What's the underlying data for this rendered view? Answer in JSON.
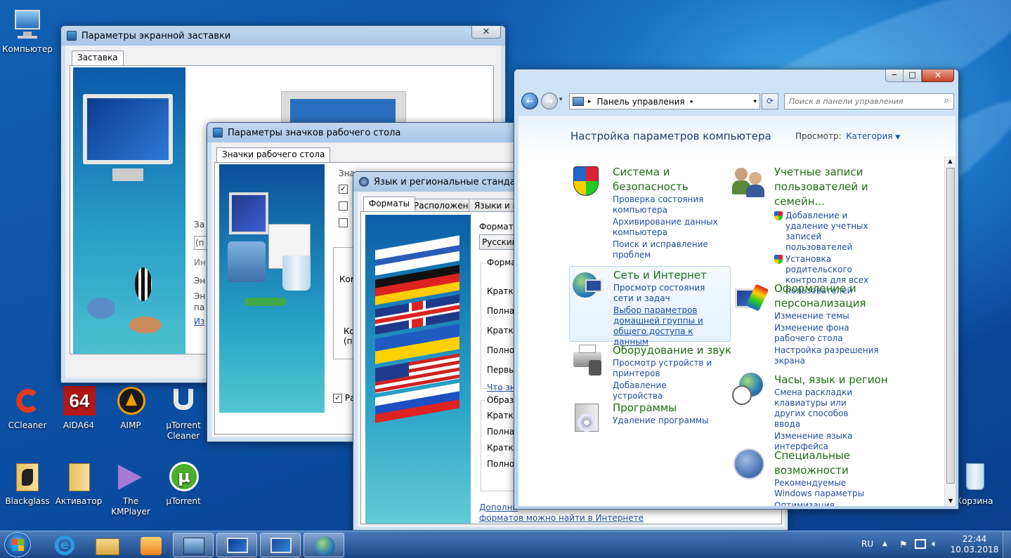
{
  "desktop": {
    "icons": [
      {
        "label": "Компьютер"
      },
      {
        "label": "CCleaner"
      },
      {
        "label": "AIDA64"
      },
      {
        "label": "AIMP"
      },
      {
        "label": "µTorrent Cleaner"
      },
      {
        "label": "Blackglass"
      },
      {
        "label": "Активатор"
      },
      {
        "label": "The KMPlayer"
      },
      {
        "label": "µTorrent"
      },
      {
        "label": "Корзина"
      }
    ],
    "aida_badge": "64"
  },
  "screensaver_window": {
    "title": "Параметры экранной заставки",
    "tab": "Заставка",
    "partial": [
      "За",
      "(п",
      "Ин",
      "Эн",
      "Эн",
      "па",
      "Из"
    ]
  },
  "icons_window": {
    "title": "Параметры значков рабочего стола",
    "tab": "Значки рабочего стола",
    "partial": [
      "Знач",
      "Ком",
      "Ко",
      "(п",
      "Ра"
    ]
  },
  "region_window": {
    "title": "Язык и региональные стандарты",
    "tabs": [
      "Форматы",
      "Расположение",
      "Языки и кл"
    ],
    "format_label": "Формат:",
    "format_value": "Русский",
    "group1": "Формат",
    "rows1": [
      "Краткая",
      "Полная",
      "Краткое",
      "Полное",
      "Первый"
    ],
    "link1": "Что зна",
    "group2": "Образц",
    "rows2": [
      "Краткая",
      "Полная",
      "Краткое",
      "Полное"
    ],
    "bottom_link_1": "Дополни",
    "bottom_link_2": "форматов можно найти в Интернете"
  },
  "control_panel": {
    "title_buttons": {
      "minimize": "‒",
      "maximize": "□",
      "close": "✕"
    },
    "address": "Панель управления",
    "search_placeholder": "Поиск в панели управления",
    "heading": "Настройка параметров компьютера",
    "view_label": "Просмотр:",
    "view_value": "Категория",
    "categories_left": [
      {
        "title": "Система и безопасность",
        "links": [
          "Проверка состояния компьютера",
          "Архивирование данных компьютера",
          "Поиск и исправление проблем"
        ]
      },
      {
        "title": "Сеть и Интернет",
        "links": [
          "Просмотр состояния сети и задач",
          "Выбор параметров домашней группы и общего доступа к данным"
        ]
      },
      {
        "title": "Оборудование и звук",
        "links": [
          "Просмотр устройств и принтеров",
          "Добавление устройства"
        ]
      },
      {
        "title": "Программы",
        "links": [
          "Удаление программы"
        ]
      }
    ],
    "categories_right": [
      {
        "title": "Учетные записи пользователей и семейн...",
        "links": [
          "Добавление и удаление учетных записей пользователей",
          "Установка родительского контроля для всех пользователей"
        ]
      },
      {
        "title": "Оформление и персонализация",
        "links": [
          "Изменение темы",
          "Изменение фона рабочего стола",
          "Настройка разрешения экрана"
        ]
      },
      {
        "title": "Часы, язык и регион",
        "links": [
          "Смена раскладки клавиатуры или других способов ввода",
          "Изменение языка интерфейса"
        ]
      },
      {
        "title": "Специальные возможности",
        "links": [
          "Рекомендуемые Windows параметры",
          "Оптимизация изображения"
        ]
      }
    ]
  },
  "taskbar": {
    "lang": "RU",
    "time": "22:44",
    "date": "10.03.2018"
  },
  "colors": {
    "category_title": "#1e6e12",
    "link": "#1f4fa3",
    "heading": "#1e3f6e"
  }
}
